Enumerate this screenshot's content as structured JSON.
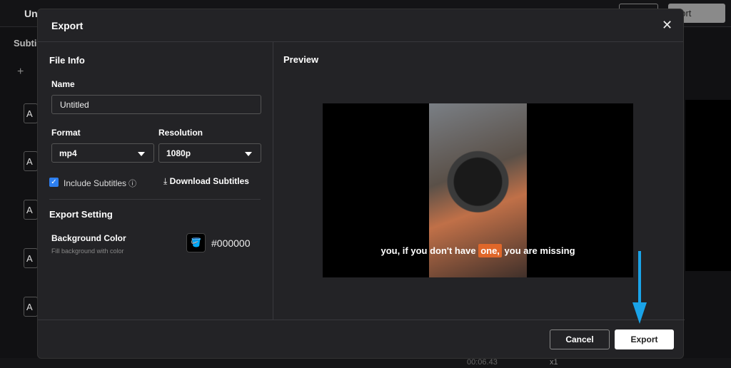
{
  "background": {
    "title_partial": "Un",
    "panel_partial": "Subti",
    "export_partial": "port",
    "card_letter": "A",
    "time": "00:06.43",
    "speed": "x1"
  },
  "dialog": {
    "title": "Export",
    "file_info": {
      "heading": "File Info",
      "name_label": "Name",
      "name_value": "Untitled",
      "format_label": "Format",
      "format_value": "mp4",
      "resolution_label": "Resolution",
      "resolution_value": "1080p",
      "include_subtitles_label": "Include Subtitles",
      "include_subtitles_checked": true,
      "download_subtitles_label": "Download Subtitles"
    },
    "export_setting": {
      "heading": "Export Setting",
      "bg_color_label": "Background Color",
      "bg_color_hint": "Fill background with color",
      "bg_color_value": "#000000"
    },
    "preview": {
      "heading": "Preview",
      "subtitle_before": "you, if you don't have ",
      "subtitle_highlight": "one,",
      "subtitle_after": " you are missing",
      "highlight_color": "#e0672a"
    },
    "buttons": {
      "cancel": "Cancel",
      "export": "Export"
    }
  },
  "colors": {
    "accent": "#2d7ff0",
    "annotation_arrow": "#1aa3e8"
  }
}
